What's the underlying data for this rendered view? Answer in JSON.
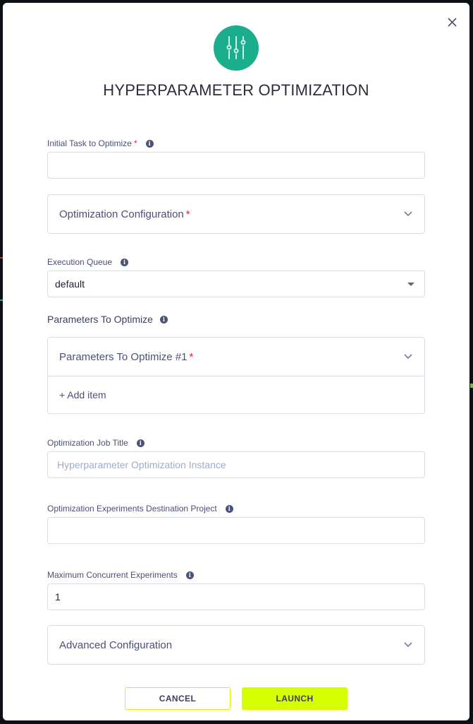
{
  "dialog": {
    "title": "HYPERPARAMETER OPTIMIZATION",
    "logo_icon": "sliders-icon",
    "close_icon": "close-icon",
    "accent_color": "#1aae8c",
    "launch_color": "#d5fe00"
  },
  "fields": {
    "initial_task": {
      "label": "Initial Task to Optimize",
      "required": "*",
      "value": ""
    },
    "optimization_config": {
      "label": "Optimization Configuration",
      "required": "*"
    },
    "execution_queue": {
      "label": "Execution Queue",
      "value": "default"
    },
    "parameters": {
      "label": "Parameters To Optimize",
      "item_label": "Parameters To Optimize #1",
      "required": "*",
      "add_item": "+ Add item"
    },
    "job_title": {
      "label": "Optimization Job Title",
      "placeholder": "Hyperparameter Optimization Instance",
      "value": ""
    },
    "destination_project": {
      "label": "Optimization Experiments Destination Project",
      "value": ""
    },
    "max_concurrent": {
      "label": "Maximum Concurrent Experiments",
      "value": "1"
    },
    "advanced_config": {
      "label": "Advanced Configuration"
    }
  },
  "buttons": {
    "cancel": "CANCEL",
    "launch": "LAUNCH"
  },
  "info_glyph": "i"
}
